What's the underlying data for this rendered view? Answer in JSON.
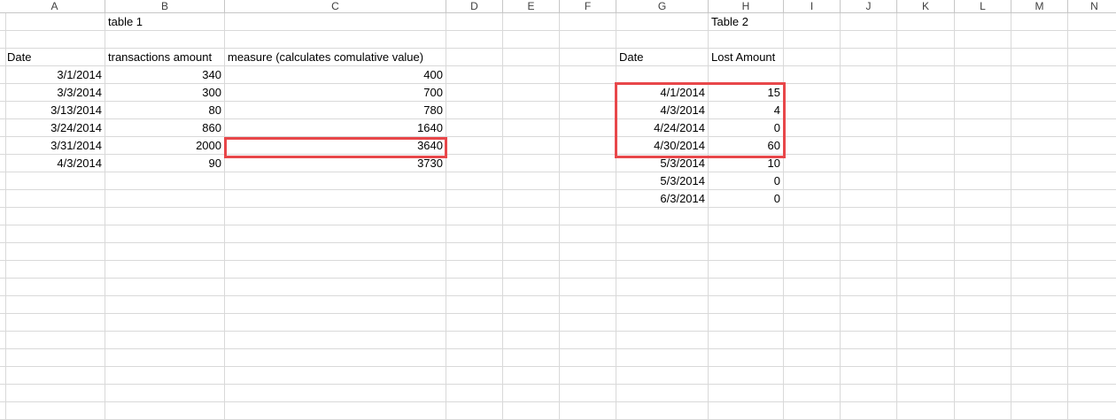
{
  "columns": [
    "A",
    "B",
    "C",
    "D",
    "E",
    "F",
    "G",
    "H",
    "I",
    "J",
    "K",
    "L",
    "M",
    "N"
  ],
  "rows": [
    {
      "B": "table 1",
      "H": "Table 2"
    },
    {},
    {
      "A": "Date",
      "B": "transactions amount",
      "C": "measure (calculates comulative value)",
      "G": "Date",
      "H": "Lost Amount"
    },
    {
      "A": "3/1/2014",
      "B": "340",
      "C": "400"
    },
    {
      "A": "3/3/2014",
      "B": "300",
      "C": "700",
      "G": "4/1/2014",
      "H": "15"
    },
    {
      "A": "3/13/2014",
      "B": "80",
      "C": "780",
      "G": "4/3/2014",
      "H": "4"
    },
    {
      "A": "3/24/2014",
      "B": "860",
      "C": "1640",
      "G": "4/24/2014",
      "H": "0"
    },
    {
      "A": "3/31/2014",
      "B": "2000",
      "C": "3640",
      "G": "4/30/2014",
      "H": "60"
    },
    {
      "A": "4/3/2014",
      "B": "90",
      "C": "3730",
      "G": "5/3/2014",
      "H": "10"
    },
    {
      "G": "5/3/2014",
      "H": "0"
    },
    {
      "G": "6/3/2014",
      "H": "0"
    },
    {},
    {},
    {},
    {},
    {},
    {},
    {},
    {},
    {},
    {},
    {},
    {}
  ],
  "highlight_color": "#e8474a"
}
